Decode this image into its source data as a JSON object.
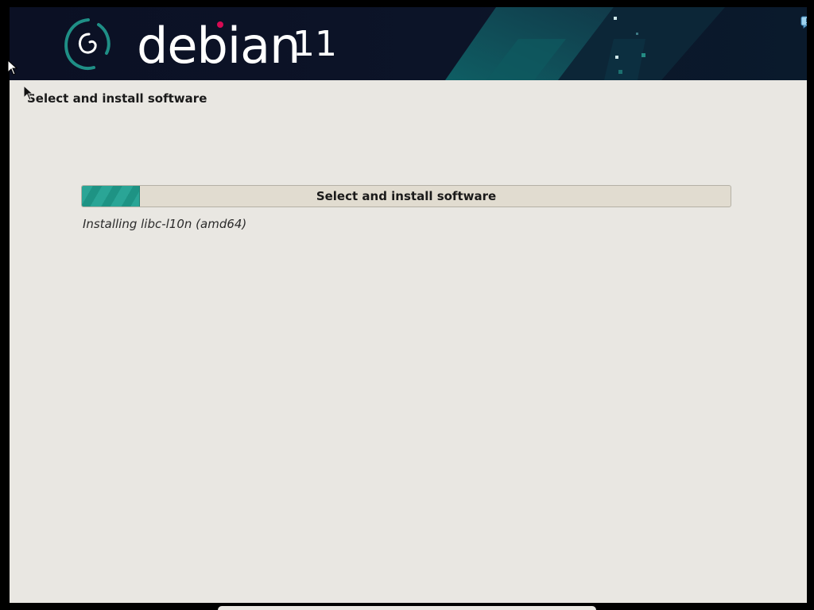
{
  "banner": {
    "brand": "debian",
    "version": "11",
    "logo_icon": "debian-swirl-icon",
    "background_color": "#0b1024",
    "accent_color": "#0f6b6e",
    "dot_color": "#d70a53"
  },
  "page": {
    "step_title": "Select and install software"
  },
  "progress": {
    "label": "Select and install software",
    "fraction": 0.09,
    "fill_color": "#2aa596",
    "status": "Installing libc-l10n (amd64)"
  },
  "icons": {
    "notification": "notification-speech-bubble-icon",
    "cursor": "mouse-pointer-icon"
  },
  "colors": {
    "window_background": "#e9e7e2",
    "screen_background": "#000000"
  }
}
